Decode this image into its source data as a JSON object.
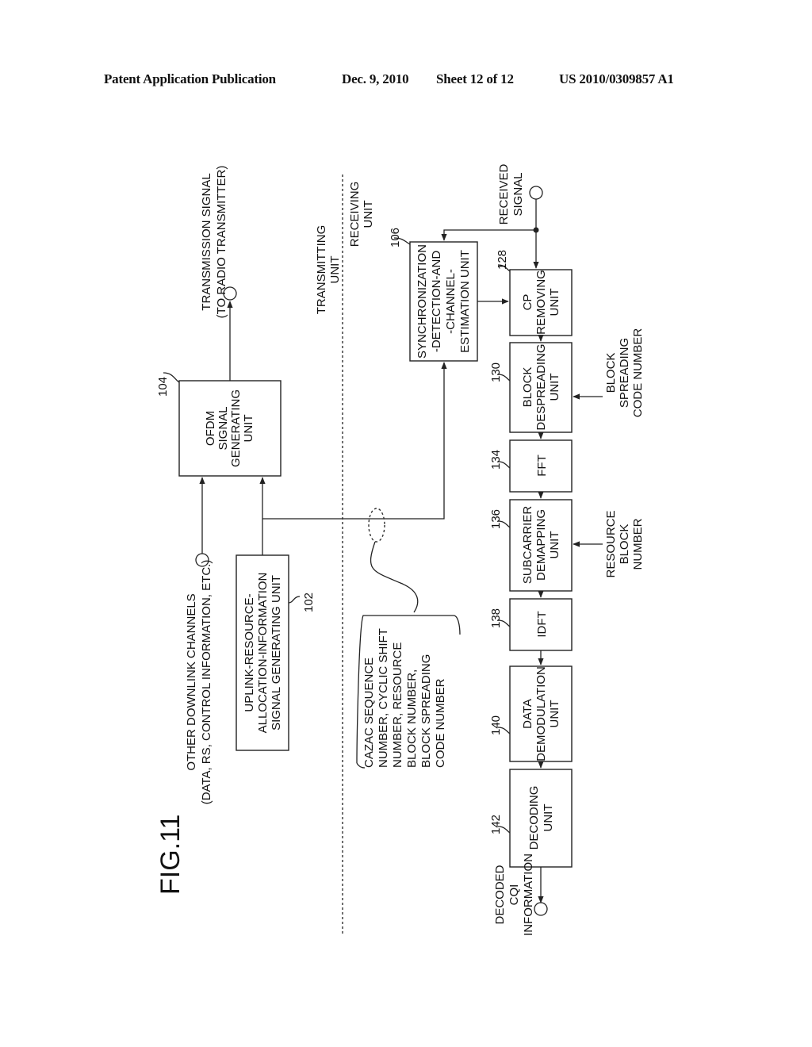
{
  "header": {
    "publication": "Patent Application Publication",
    "date": "Dec. 9, 2010",
    "sheet": "Sheet 12 of 12",
    "patent_number": "US 2010/0309857 A1"
  },
  "figure": {
    "title": "FIG.11",
    "orientation": "rotated 90° counter-clockwise",
    "section_labels": {
      "transmitting": [
        "TRANSMITTING",
        "UNIT"
      ],
      "receiving": [
        "RECEIVING",
        "UNIT"
      ]
    },
    "terminals": {
      "other_downlink": [
        "OTHER DOWNLINK CHANNELS",
        "(DATA, RS, CONTROL INFORMATION, ETC.)"
      ],
      "transmission_signal": [
        "TRANSMISSION SIGNAL",
        "(TO RADIO TRANSMITTER)"
      ],
      "received_signal": [
        "RECEIVED",
        "SIGNAL"
      ],
      "decoded_cqi": [
        "DECODED",
        "CQI",
        "INFORMATION"
      ]
    },
    "blocks": {
      "b104": {
        "ref": "104",
        "lines": [
          "OFDM",
          "SIGNAL",
          "GENERATING",
          "UNIT"
        ]
      },
      "b102": {
        "ref": "102",
        "lines": [
          "UPLINK-RESOURCE-",
          "ALLOCATION-INFORMATION",
          "SIGNAL GENERATING UNIT"
        ]
      },
      "b106": {
        "ref": "106",
        "lines": [
          "SYNCHRONIZATION",
          "-DETECTION-AND",
          "-CHANNEL-",
          "ESTIMATION UNIT"
        ]
      },
      "b128": {
        "ref": "128",
        "lines": [
          "CP",
          "REMOVING",
          "UNIT"
        ]
      },
      "b130": {
        "ref": "130",
        "lines": [
          "BLOCK",
          "DESPREADING",
          "UNIT"
        ]
      },
      "b134": {
        "ref": "134",
        "lines": [
          "FFT"
        ]
      },
      "b136": {
        "ref": "136",
        "lines": [
          "SUBCARRIER",
          "DEMAPPING",
          "UNIT"
        ]
      },
      "b138": {
        "ref": "138",
        "lines": [
          "IDFT"
        ]
      },
      "b140": {
        "ref": "140",
        "lines": [
          "DATA",
          "DEMODULATION",
          "UNIT"
        ]
      },
      "b142": {
        "ref": "142",
        "lines": [
          "DECODING",
          "UNIT"
        ]
      }
    },
    "side_inputs": {
      "block_spreading_code": [
        "BLOCK",
        "SPREADING",
        "CODE NUMBER"
      ],
      "resource_block_number": [
        "RESOURCE",
        "BLOCK",
        "NUMBER"
      ]
    },
    "annotation": {
      "lines": [
        "CAZAC SEQUENCE",
        "NUMBER, CYCLIC SHIFT",
        "NUMBER, RESOURCE",
        "BLOCK NUMBER,",
        "BLOCK SPREADING",
        "CODE NUMBER"
      ]
    }
  }
}
